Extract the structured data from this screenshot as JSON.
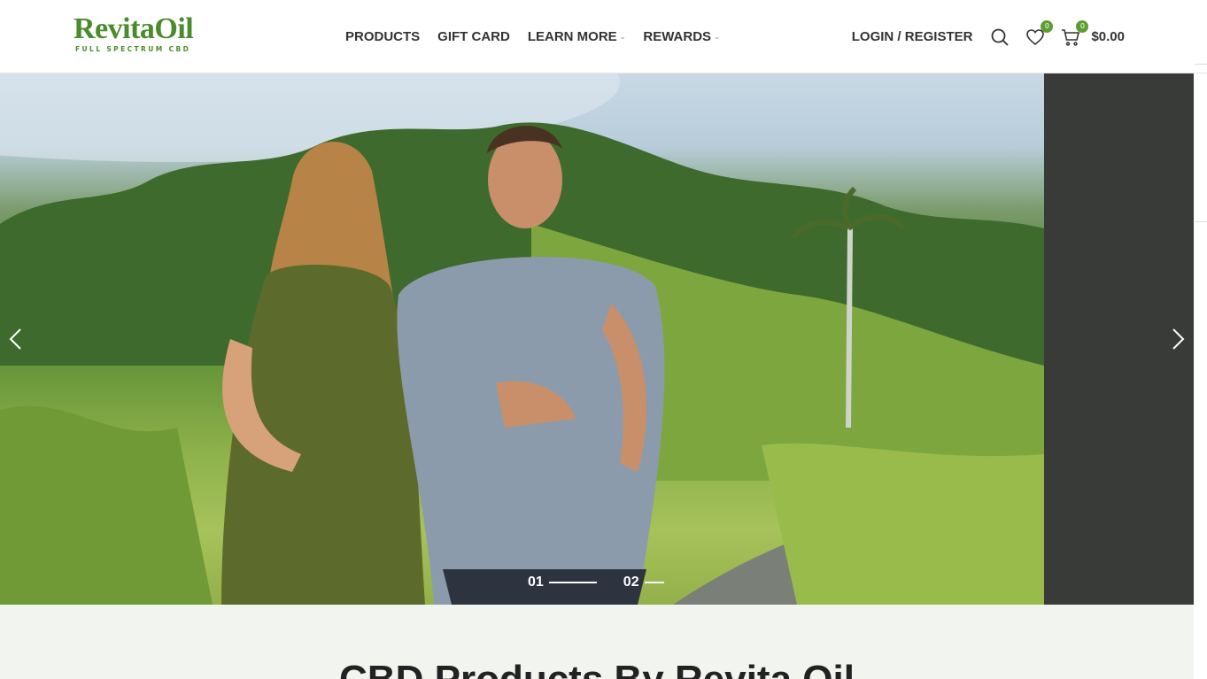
{
  "brand": {
    "name": "RevitaOil",
    "tagline": "FULL SPECTRUM CBD",
    "color": "#4a8b2c"
  },
  "nav": {
    "items": [
      {
        "label": "PRODUCTS",
        "has_dropdown": false
      },
      {
        "label": "GIFT CARD",
        "has_dropdown": false
      },
      {
        "label": "LEARN MORE",
        "has_dropdown": true
      },
      {
        "label": "REWARDS",
        "has_dropdown": true
      }
    ]
  },
  "header_tools": {
    "login_label": "LOGIN / REGISTER",
    "search_icon": "search-icon",
    "wishlist_icon": "heart-icon",
    "wishlist_count": "0",
    "cart_icon": "cart-icon",
    "cart_count": "0",
    "cart_total": "$0.00",
    "badge_color": "#5a9e32"
  },
  "hero": {
    "slides": [
      {
        "number": "01",
        "active": true
      },
      {
        "number": "02",
        "active": false
      }
    ],
    "prev_icon": "chevron-left-icon",
    "next_icon": "chevron-right-icon",
    "side_panel_color": "#393b39"
  },
  "section": {
    "title": "CBD Products By Revita Oil"
  }
}
